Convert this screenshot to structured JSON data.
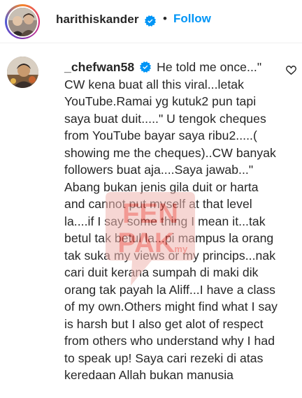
{
  "post_header": {
    "username": "harithiskander",
    "separator": "•",
    "follow_label": "Follow",
    "verified": true
  },
  "comment": {
    "username": "_chefwan58",
    "verified": true,
    "text": "He told me once...\" CW kena buat all this viral...letak YouTube.Ramai yg kutuk2 pun tapi saya buat duit.....\" U tengok cheques from YouTube bayar saya ribu2.....( showing me the cheques)..CW banyak followers buat aja....Saya jawab...\" Abang bukan jenis gila duit or harta and cannot put myself at that level la....if I say some thing I mean it...tak betul tak betul la...pi mampus la orang tak suka my views or my princips...nak cari duit kerana sumpah di maki dik orang tak payah la Aliff...I have a class of my own.Others might find what I say is harsh but I also get alot of respect from others who understand why I had to speak up! Saya cari rezeki di atas keredaan Allah bukan manusia"
  },
  "watermark": {
    "line1": "FEN",
    "line2": "PAK",
    "suffix": ".my"
  },
  "icons": {
    "verified": "verified-badge-icon",
    "like": "heart-icon"
  },
  "colors": {
    "follow": "#0095f6",
    "verified": "#0095f6",
    "text": "#262626",
    "watermark": "#e8463b"
  }
}
